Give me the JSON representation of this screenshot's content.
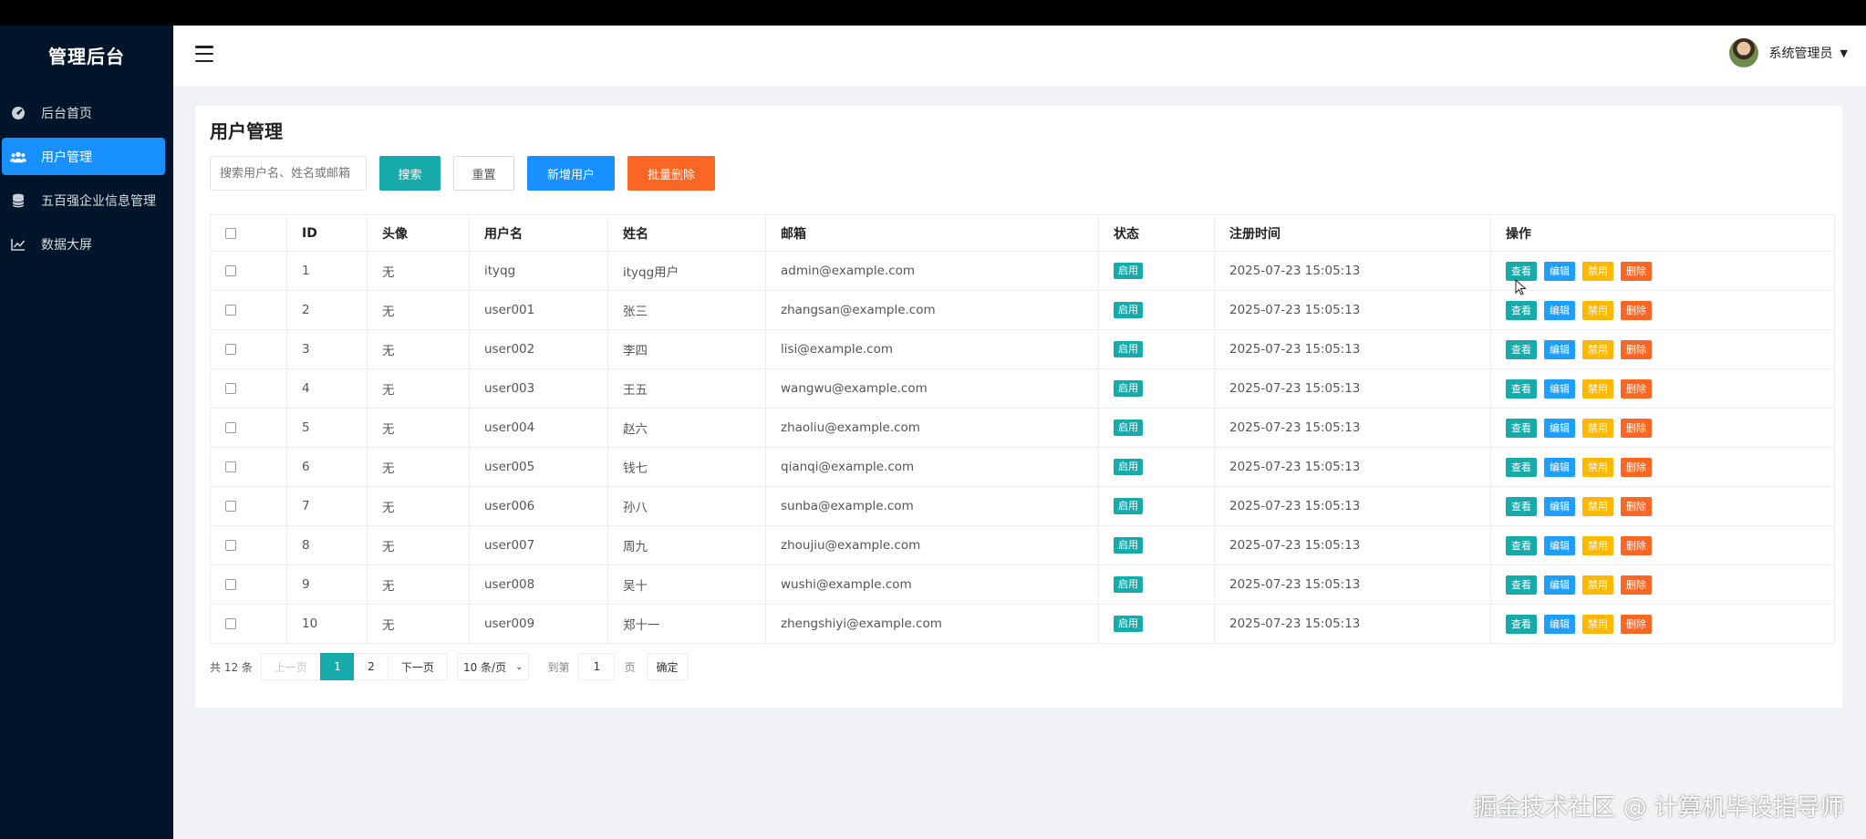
{
  "app": {
    "brand": "管理后台"
  },
  "sidebar": {
    "items": [
      {
        "label": "后台首页",
        "icon": "dashboard-icon",
        "active": false
      },
      {
        "label": "用户管理",
        "icon": "users-icon",
        "active": true
      },
      {
        "label": "五百强企业信息管理",
        "icon": "database-icon",
        "active": false
      },
      {
        "label": "数据大屏",
        "icon": "line-chart-icon",
        "active": false
      }
    ]
  },
  "header": {
    "user_name": "系统管理员"
  },
  "page": {
    "title": "用户管理"
  },
  "toolbar": {
    "search_placeholder": "搜索用户名、姓名或邮箱",
    "search_label": "搜索",
    "reset_label": "重置",
    "add_label": "新增用户",
    "batch_delete_label": "批量删除"
  },
  "table": {
    "columns": [
      "",
      "ID",
      "头像",
      "用户名",
      "姓名",
      "邮箱",
      "状态",
      "注册时间",
      "操作"
    ],
    "action_labels": {
      "view": "查看",
      "edit": "编辑",
      "disable": "禁用",
      "delete": "删除"
    },
    "rows": [
      {
        "id": "1",
        "avatar": "无",
        "username": "ityqg",
        "name": "ityqg用户",
        "email": "admin@example.com",
        "status": "启用",
        "registered": "2025-07-23 15:05:13"
      },
      {
        "id": "2",
        "avatar": "无",
        "username": "user001",
        "name": "张三",
        "email": "zhangsan@example.com",
        "status": "启用",
        "registered": "2025-07-23 15:05:13"
      },
      {
        "id": "3",
        "avatar": "无",
        "username": "user002",
        "name": "李四",
        "email": "lisi@example.com",
        "status": "启用",
        "registered": "2025-07-23 15:05:13"
      },
      {
        "id": "4",
        "avatar": "无",
        "username": "user003",
        "name": "王五",
        "email": "wangwu@example.com",
        "status": "启用",
        "registered": "2025-07-23 15:05:13"
      },
      {
        "id": "5",
        "avatar": "无",
        "username": "user004",
        "name": "赵六",
        "email": "zhaoliu@example.com",
        "status": "启用",
        "registered": "2025-07-23 15:05:13"
      },
      {
        "id": "6",
        "avatar": "无",
        "username": "user005",
        "name": "钱七",
        "email": "qianqi@example.com",
        "status": "启用",
        "registered": "2025-07-23 15:05:13"
      },
      {
        "id": "7",
        "avatar": "无",
        "username": "user006",
        "name": "孙八",
        "email": "sunba@example.com",
        "status": "启用",
        "registered": "2025-07-23 15:05:13"
      },
      {
        "id": "8",
        "avatar": "无",
        "username": "user007",
        "name": "周九",
        "email": "zhoujiu@example.com",
        "status": "启用",
        "registered": "2025-07-23 15:05:13"
      },
      {
        "id": "9",
        "avatar": "无",
        "username": "user008",
        "name": "吴十",
        "email": "wushi@example.com",
        "status": "启用",
        "registered": "2025-07-23 15:05:13"
      },
      {
        "id": "10",
        "avatar": "无",
        "username": "user009",
        "name": "郑十一",
        "email": "zhengshiyi@example.com",
        "status": "启用",
        "registered": "2025-07-23 15:05:13"
      }
    ]
  },
  "pagination": {
    "total": "共 12 条",
    "prev": "上一页",
    "pages": [
      "1",
      "2"
    ],
    "current": "1",
    "next": "下一页",
    "page_size": "10 条/页",
    "goto_label": "到第",
    "goto_value": "1",
    "goto_suffix": "页",
    "confirm": "确定"
  },
  "watermark": "掘金技术社区 @ 计算机毕设指导师",
  "colors": {
    "sidebar_bg": "#001529",
    "primary": "#1890ff",
    "teal": "#16aaaa",
    "orange": "#fa6724",
    "yellow": "#ffb800"
  }
}
